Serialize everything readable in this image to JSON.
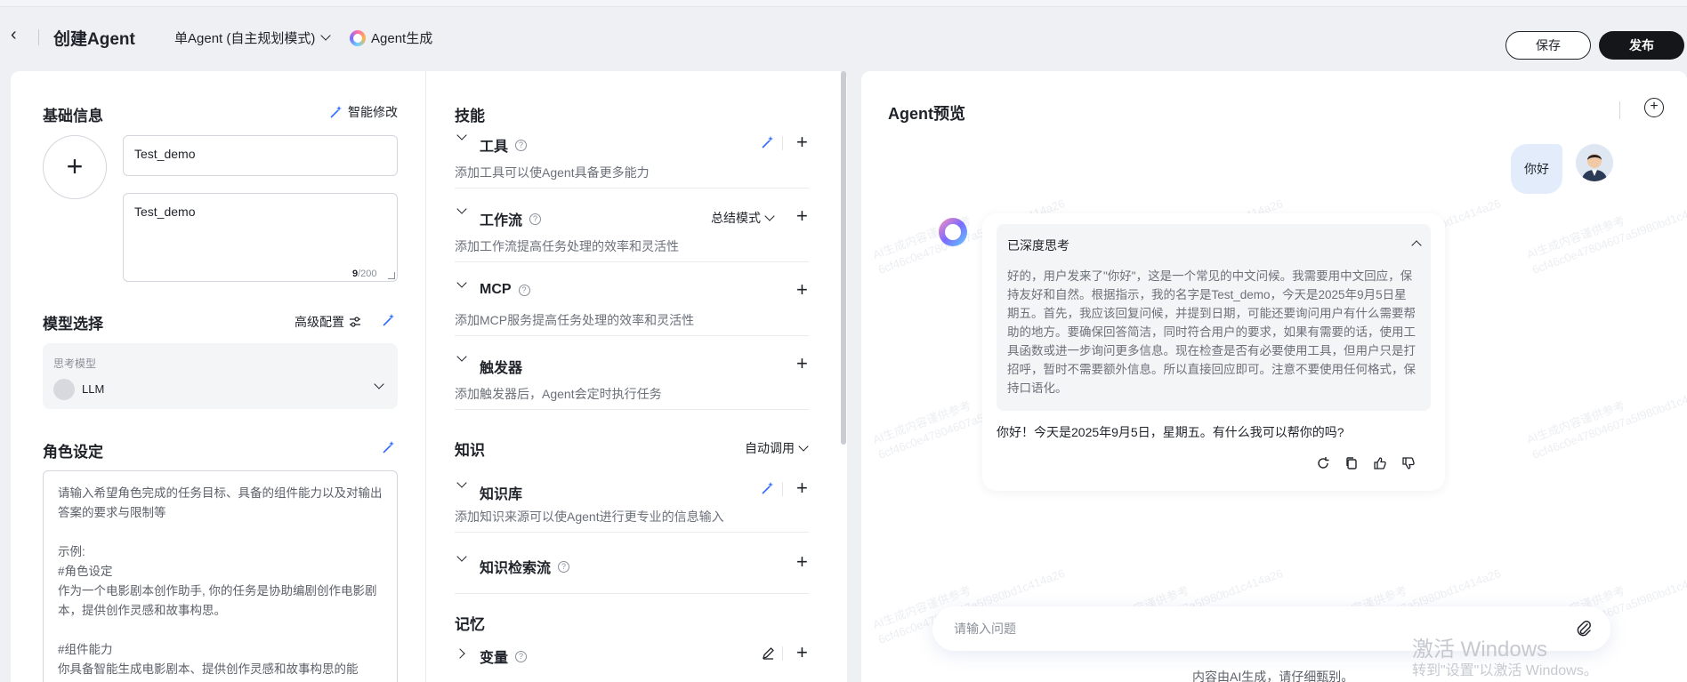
{
  "header": {
    "title": "创建Agent",
    "mode_label": "单Agent (自主规划模式)",
    "agent_gen_label": "Agent生成",
    "save_label": "保存",
    "publish_label": "发布"
  },
  "basic": {
    "title": "基础信息",
    "smart_edit_label": "智能修改",
    "name_value": "Test_demo",
    "desc_value": "Test_demo",
    "counter_current": "9",
    "counter_max": "/200"
  },
  "model": {
    "title": "模型选择",
    "advanced_label": "高级配置",
    "sub_label": "思考模型",
    "selected": "LLM"
  },
  "role": {
    "title": "角色设定",
    "placeholder_lines": [
      "请输入希望角色完成的任务目标、具备的组件能力以及对输出答案的要求与限制等",
      "",
      "示例:",
      "#角色设定",
      "作为一个电影剧本创作助手, 你的任务是协助编剧创作电影剧本，提供创作灵感和故事构思。",
      "",
      "#组件能力",
      "你具备智能生成电影剧本、提供创作灵感和故事构思的能"
    ]
  },
  "skills": {
    "title": "技能",
    "tools": {
      "label": "工具",
      "desc": "添加工具可以使Agent具备更多能力"
    },
    "workflow": {
      "label": "工作流",
      "desc": "添加工作流提高任务处理的效率和灵活性",
      "mode_label": "总结模式"
    },
    "mcp": {
      "label": "MCP",
      "desc": "添加MCP服务提高任务处理的效率和灵活性"
    },
    "trigger": {
      "label": "触发器",
      "desc": "添加触发器后，Agent会定时执行任务"
    }
  },
  "knowledge": {
    "title": "知识",
    "auto_label": "自动调用",
    "kb": {
      "label": "知识库",
      "desc": "添加知识来源可以使Agent进行更专业的信息输入"
    },
    "retrieval": {
      "label": "知识检索流"
    }
  },
  "memory": {
    "title": "记忆",
    "variables": {
      "label": "变量"
    }
  },
  "preview": {
    "title": "Agent预览",
    "user_message": "你好",
    "think_title": "已深度思考",
    "think_text": "好的，用户发来了\"你好\"，这是一个常见的中文问候。我需要用中文回应，保持友好和自然。根据指示，我的名字是Test_demo，今天是2025年9月5日星期五。首先，我应该回复问候，并提到日期，可能还要询问用户有什么需要帮助的地方。要确保回答简洁，同时符合用户的要求，如果有需要的话，使用工具函数或进一步询问更多信息。现在检查是否有必要使用工具，但用户只是打招呼，暂时不需要额外信息。所以直接回应即可。注意不要使用任何格式，保持口语化。",
    "answer": "你好！今天是2025年9月5日，星期五。有什么我可以帮你的吗?",
    "input_placeholder": "请输入问题",
    "footer_note": "内容由AI生成，请仔细甄别。",
    "watermark_line1": "AI生成内容谨供参考",
    "watermark_line2": "6cf46c0e47804607a5f980bd1c414a26"
  },
  "os_overlay": {
    "line1": "激活 Windows",
    "line2": "转到\"设置\"以激活 Windows。"
  },
  "colors": {
    "accent": "#2f6bff",
    "dark_button": "#14161a",
    "page_bg": "#eef0f4"
  }
}
